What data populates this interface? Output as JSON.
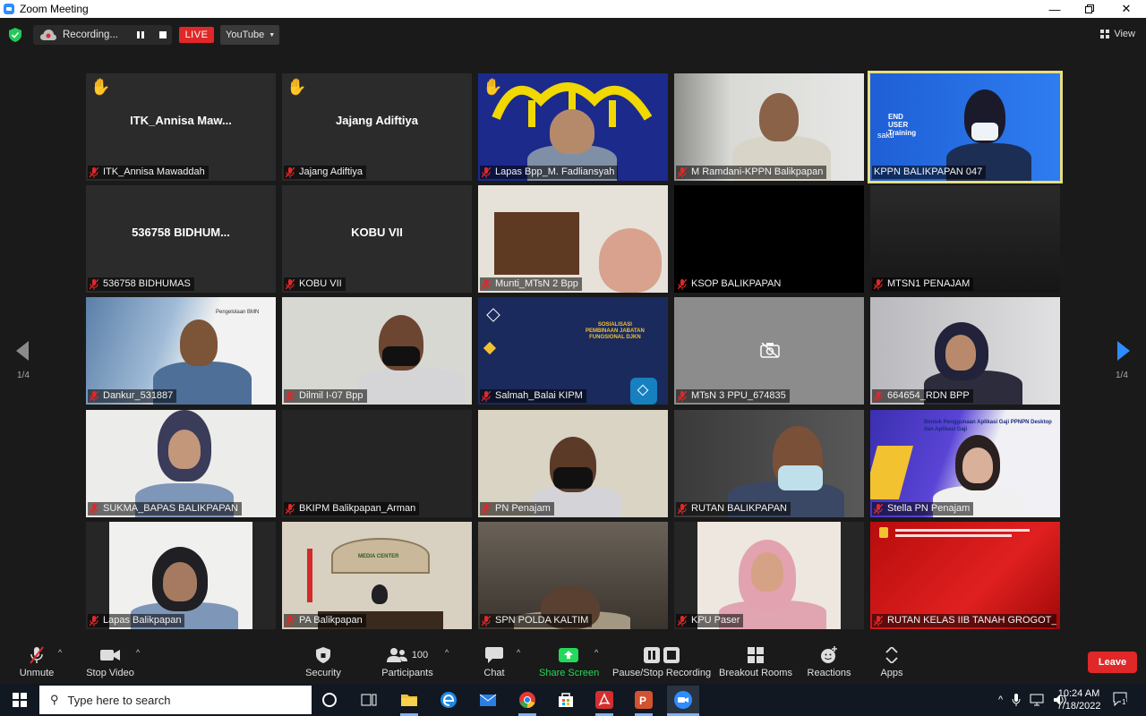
{
  "window": {
    "title": "Zoom Meeting"
  },
  "topbar": {
    "recording_label": "Recording...",
    "live_label": "LIVE",
    "stream_target": "YouTube",
    "view_label": "View"
  },
  "gallery": {
    "page_indicator_left": "1/4",
    "page_indicator_right": "1/4",
    "tiles": [
      {
        "name": "ITK_Annisa Mawaddah",
        "center_name": "ITK_Annisa  Maw...",
        "hand": true
      },
      {
        "name": "Jajang Adiftiya",
        "center_name": "Jajang Adiftiya",
        "hand": true
      },
      {
        "name": "Lapas Bpp_M. Fadliansyah",
        "hand": true
      },
      {
        "name": "M Ramdani-KPPN Balikpapan"
      },
      {
        "name": "KPPN BALIKPAPAN 047",
        "selected": true,
        "slide_text": [
          "END",
          "USER",
          "Training",
          "sakti"
        ]
      },
      {
        "name": "536758 BIDHUMAS",
        "center_name": "536758  BIDHUM..."
      },
      {
        "name": "KOBU VII",
        "center_name": "KOBU VII"
      },
      {
        "name": "Munti_MTsN 2 Bpp"
      },
      {
        "name": "KSOP BALIKPAPAN"
      },
      {
        "name": "MTSN1 PENAJAM"
      },
      {
        "name": "Dankur_531887",
        "slide_text": [
          "Pengelolaan BMN"
        ]
      },
      {
        "name": "Dilmil I-07 Bpp"
      },
      {
        "name": "Salmah_Balai KIPM",
        "slide_text": [
          "SOSIALISASI",
          "PEMBINAAN JABATAN",
          "FUNGSIONAL DJKN"
        ]
      },
      {
        "name": "MTsN 3 PPU_674835"
      },
      {
        "name": "664654_RDN BPP"
      },
      {
        "name": "SUKMA_BAPAS BALIKPAPAN"
      },
      {
        "name": "BKIPM Balikpapan_Arman"
      },
      {
        "name": "PN Penajam"
      },
      {
        "name": "RUTAN BALIKPAPAN"
      },
      {
        "name": "Stella PN Penajam",
        "slide_text": [
          "Bimtek Penggunaan Aplikasi Gaji PPNPN Desktop",
          "dan Aplikasi Gaji"
        ]
      },
      {
        "name": "Lapas Balikpapan"
      },
      {
        "name": "PA Balikpapan",
        "slide_text": [
          "MEDIA CENTER"
        ]
      },
      {
        "name": "SPN POLDA KALTIM"
      },
      {
        "name": "KPU Paser"
      },
      {
        "name": "RUTAN KELAS IIB TANAH GROGOT_..."
      }
    ]
  },
  "toolbar": {
    "unmute": "Unmute",
    "stop_video": "Stop Video",
    "security": "Security",
    "participants": "Participants",
    "participants_count": "100",
    "chat": "Chat",
    "share_screen": "Share Screen",
    "pause_stop_recording": "Pause/Stop Recording",
    "breakout_rooms": "Breakout Rooms",
    "reactions": "Reactions",
    "apps": "Apps",
    "leave": "Leave"
  },
  "taskbar": {
    "search_placeholder": "Type here to search",
    "time": "10:24 AM",
    "date": "7/18/2022",
    "notification_count": "1"
  },
  "colors": {
    "live_red": "#e02828",
    "share_green": "#23d959",
    "selected_border": "#e6de82",
    "nav_arrow_blue": "#2d8cff"
  }
}
